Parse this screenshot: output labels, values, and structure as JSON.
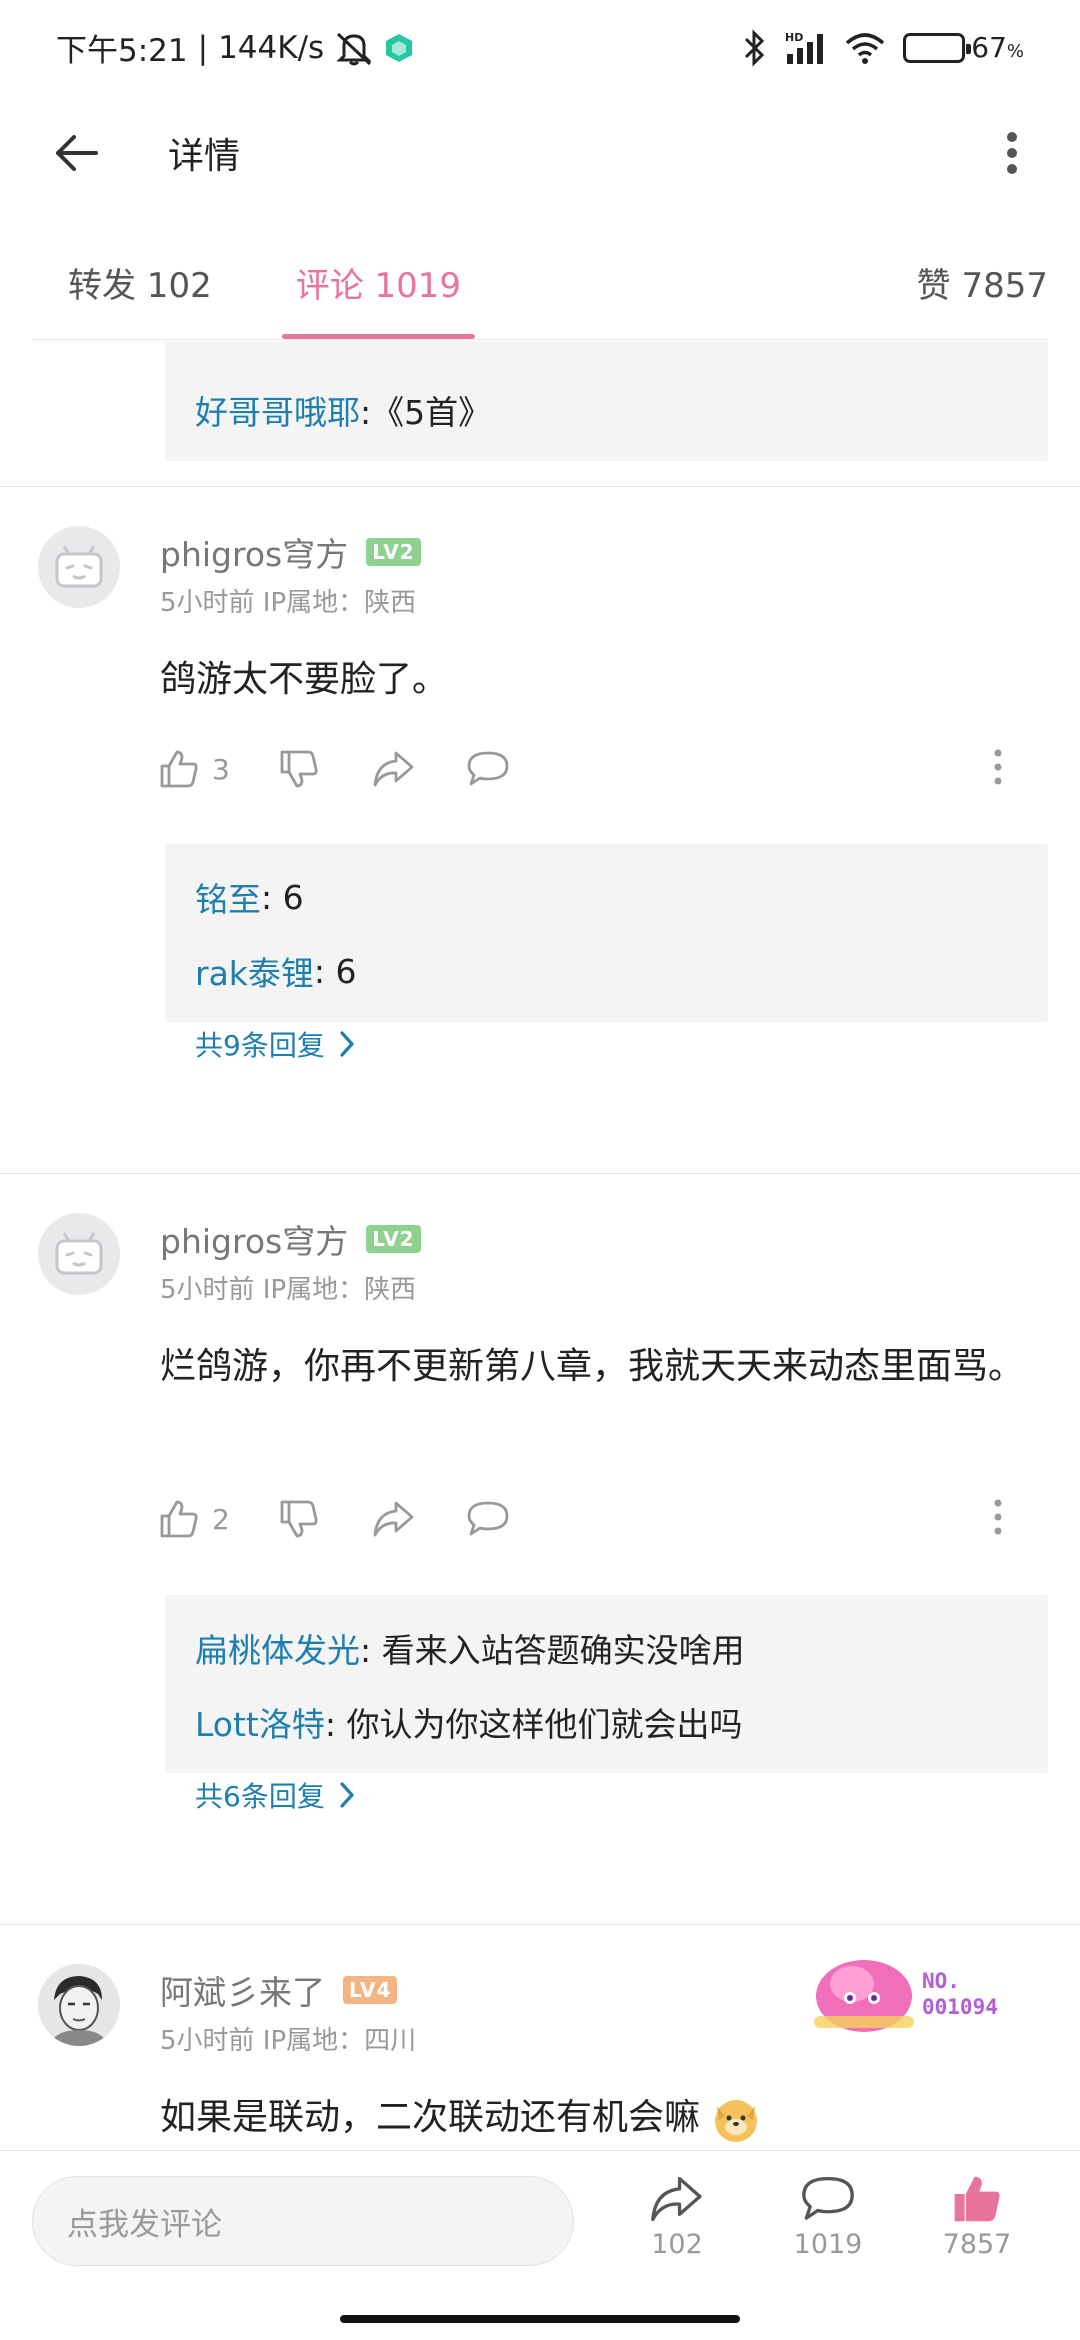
{
  "status_bar": {
    "time": "下午5:21",
    "network_speed": "144K/s",
    "battery_percent": "67",
    "battery_level": 0.67,
    "icons": [
      "mute-icon",
      "vpn-icon",
      "bluetooth-icon",
      "hd-signal-icon",
      "wifi-icon",
      "battery-icon"
    ]
  },
  "header": {
    "title": "详情"
  },
  "tabs": {
    "forward": "转发 102",
    "comment": "评论 1019",
    "like": "赞 7857",
    "active": "comment",
    "accent_color": "#e8749c"
  },
  "prev_reply": {
    "user": "好哥哥哦耶",
    "text": ":《5首》"
  },
  "comments": [
    {
      "username": "phigros穹方",
      "level": "LV2",
      "meta": "5小时前 IP属地：陕西",
      "text": "鸽游太不要脸了。",
      "likes": "3",
      "replies": [
        {
          "user": "铭至",
          "text": ": 6"
        },
        {
          "user": "rak泰锂",
          "text": ": 6"
        }
      ],
      "reply_total": "共9条回复"
    },
    {
      "username": "phigros穹方",
      "level": "LV2",
      "meta": "5小时前 IP属地：陕西",
      "text": "烂鸽游，你再不更新第八章，我就天天来动态里面骂。",
      "likes": "2",
      "replies": [
        {
          "user": "扁桃体发光",
          "text": ": 看来入站答题确实没啥用"
        },
        {
          "user": "Lott洛特",
          "text": ": 你认为你这样他们就会出吗"
        }
      ],
      "reply_total": "共6条回复"
    },
    {
      "username": "阿斌彡来了",
      "level": "LV4",
      "meta": "5小时前 IP属地：四川",
      "text": "如果是联动，二次联动还有机会嘛",
      "fan_badge_no": "NO.\n001094"
    }
  ],
  "bottom_bar": {
    "input_placeholder": "点我发评论",
    "share_count": "102",
    "reply_count": "1019",
    "like_count": "7857",
    "like_color": "#e8749c"
  }
}
